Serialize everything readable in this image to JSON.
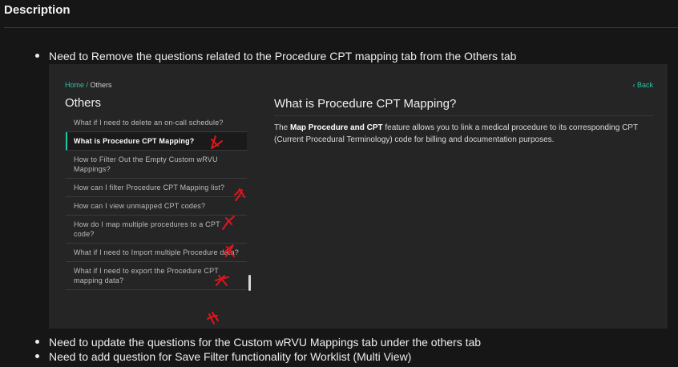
{
  "section": {
    "title": "Description"
  },
  "bullets": [
    "Need to Remove the questions related to the Procedure CPT mapping tab from the Others tab",
    "Need to update the questions for the Custom wRVU Mappings tab under the others tab",
    "Need to add question for Save Filter functionality for Worklist (Multi View)"
  ],
  "screenshot": {
    "breadcrumb": {
      "home": "Home /",
      "current": "Others"
    },
    "back_label": "Back",
    "sidebar_title": "Others",
    "faq_items": [
      "What if I need to delete an on-call schedule?",
      "What is Procedure CPT Mapping?",
      "How to Filter Out the Empty Custom wRVU Mappings?",
      "How can I filter Procedure CPT Mapping list?",
      "How can I view unmapped CPT codes?",
      "How do I map multiple procedures to a CPT code?",
      "What if I need to Import multiple Procedure data?",
      "What if I need to export the Procedure CPT mapping data?"
    ],
    "active_index": 1,
    "content": {
      "title": "What is Procedure CPT Mapping?",
      "body_prefix": "The",
      "body_bold": "Map Procedure and CPT",
      "body_suffix": "feature allows you to link a medical procedure to its corresponding CPT (Current Procedural Terminology) code for billing and documentation purposes."
    }
  },
  "colors": {
    "accent": "#21c8a6",
    "annotation": "#e0151b"
  }
}
